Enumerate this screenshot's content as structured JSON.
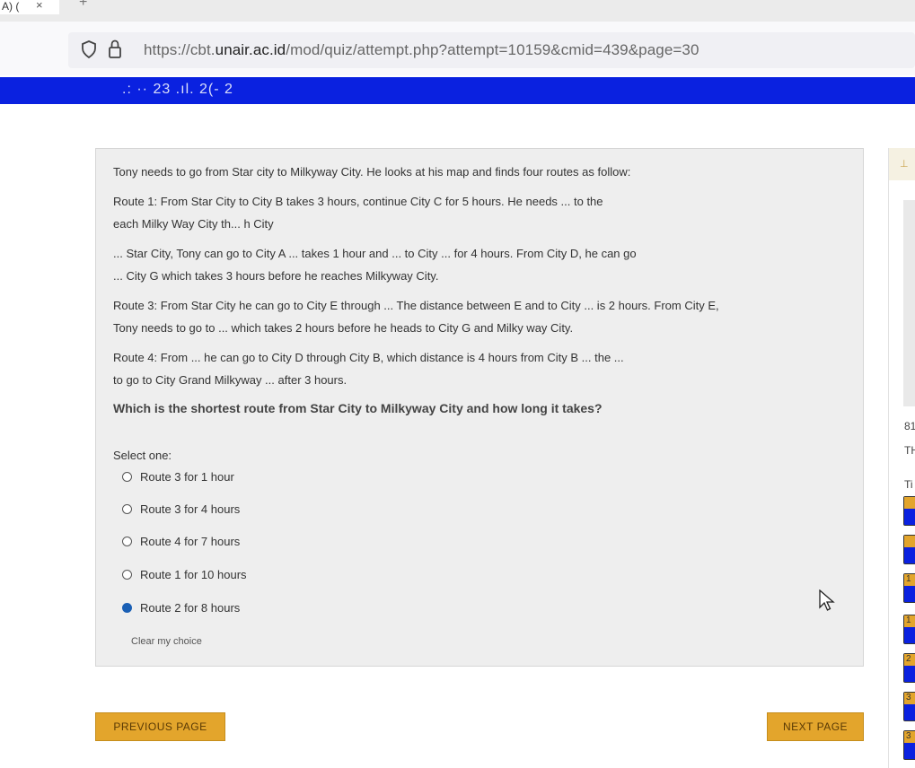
{
  "browser": {
    "tab_label": "A) (",
    "tab_close": "×",
    "new_tab": "+",
    "url_prefix": "https://cbt.",
    "url_domain": "unair.ac.id",
    "url_path": "/mod/quiz/attempt.php?attempt=10159&cmid=439&page=30"
  },
  "header": {
    "text": ".: ·· 23 .ıl. 2(- 2"
  },
  "question": {
    "lines": [
      "Tony needs to go from Star city to Milkyway City. He looks at his map and finds four routes as follow:",
      "Route 1: From Star City to City B takes 3 hours, continue City C for 5 hours. He needs ... to the",
      "each Milky Way City th... h City",
      "... Star City, Tony can go to City A ... takes 1 hour and ... to City ... for 4 hours. From City D, he can go",
      "... City G which takes 3 hours before he reaches Milkyway City.",
      "Route 3: From Star City he can go to City E through ... The distance between E and to City ... is 2 hours. From City E,",
      "Tony needs to go to ... which takes 2 hours before he heads to City G and Milky way City.",
      "Route 4: From ... he can go to City D through City B, which distance is 4 hours from City B ... the ...",
      "to go to City Grand Milkyway ... after 3 hours."
    ],
    "prompt": "Which is the shortest route from Star City to Milkyway City and how long it takes?",
    "select_one": "Select one:",
    "options": [
      {
        "label": "Route 3 for 1 hour",
        "selected": false
      },
      {
        "label": "Route 3 for 4 hours",
        "selected": false
      },
      {
        "label": "Route 4 for 7 hours",
        "selected": false
      },
      {
        "label": "Route 1 for 10 hours",
        "selected": false
      },
      {
        "label": "Route 2 for 8 hours",
        "selected": true
      }
    ],
    "clear": "Clear my choice"
  },
  "nav": {
    "prev": "PREVIOUS PAGE",
    "next": "NEXT PAGE"
  },
  "sidebar": {
    "pin": "⊥",
    "text1": "81",
    "text2": "TH",
    "text3": "Ti",
    "buttons": [
      "",
      "",
      "1",
      "1",
      "2",
      "3",
      "3"
    ]
  },
  "colors": {
    "header_blue": "#0a21e0",
    "button_gold": "#e3a52c"
  }
}
